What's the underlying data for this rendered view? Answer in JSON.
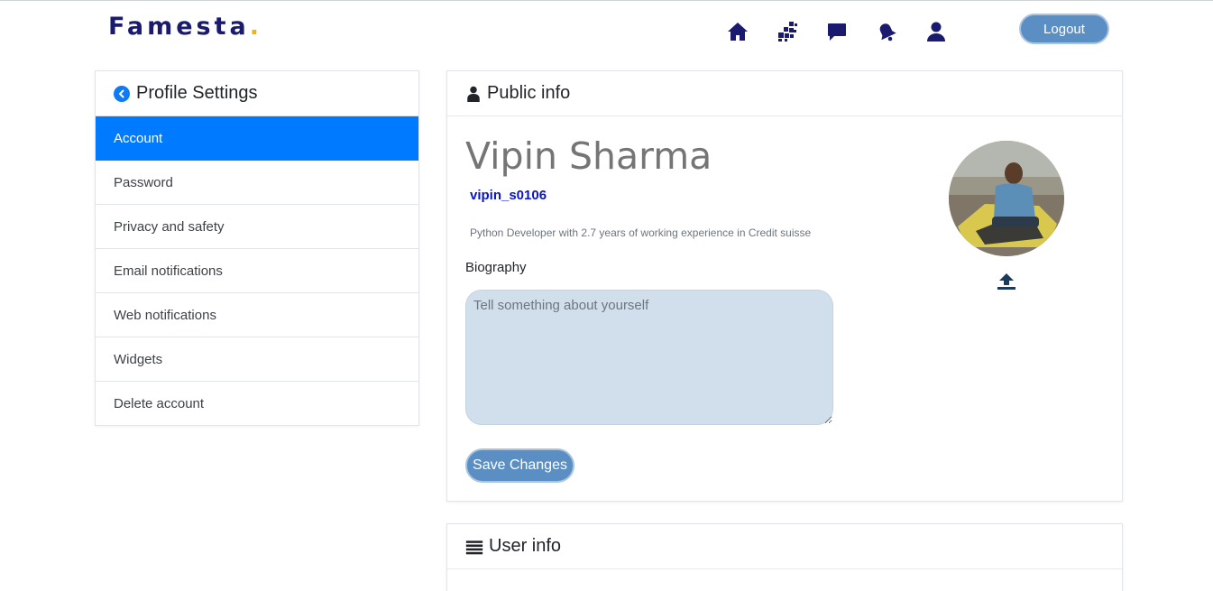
{
  "brand": {
    "name": "Famesta",
    "dot": "."
  },
  "nav": {
    "icons": [
      "home-icon",
      "grid-icon",
      "chat-icon",
      "bell-icon",
      "user-icon"
    ],
    "logout_label": "Logout"
  },
  "sidebar": {
    "title": "Profile Settings",
    "items": [
      {
        "label": "Account",
        "active": true
      },
      {
        "label": "Password",
        "active": false
      },
      {
        "label": "Privacy and safety",
        "active": false
      },
      {
        "label": "Email notifications",
        "active": false
      },
      {
        "label": "Web notifications",
        "active": false
      },
      {
        "label": "Widgets",
        "active": false
      },
      {
        "label": "Delete account",
        "active": false
      }
    ]
  },
  "public_info": {
    "title": "Public info",
    "full_name": "Vipin Sharma",
    "username": "vipin_s0106",
    "tagline": "Python Developer with 2.7 years of working experience in Credit suisse",
    "biography_label": "Biography",
    "biography_placeholder": "Tell something about yourself",
    "biography_value": "",
    "save_label": "Save Changes"
  },
  "user_info": {
    "title": "User info"
  },
  "colors": {
    "brand": "#1a1a6e",
    "accent_dot": "#f5b400",
    "active_item": "#007bff",
    "button": "#5b8fc3",
    "username": "#0a14c8",
    "textarea_bg": "#d1dfec"
  }
}
